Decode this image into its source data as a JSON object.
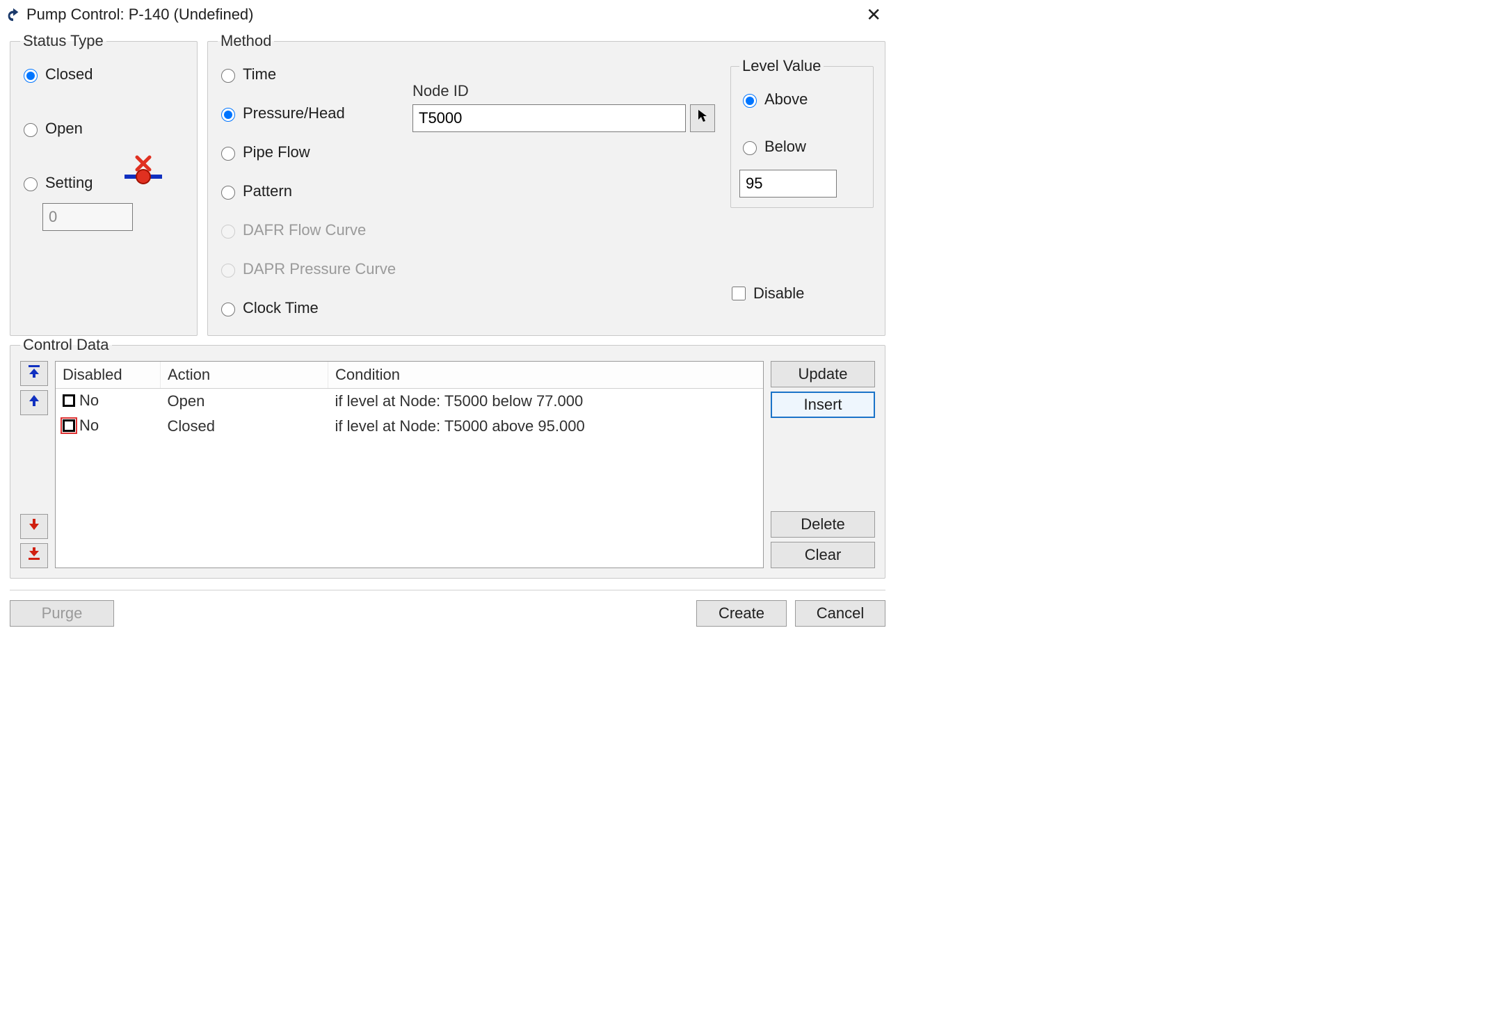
{
  "title": "Pump Control: P-140 (Undefined)",
  "status": {
    "legend": "Status Type",
    "options": {
      "closed": "Closed",
      "open": "Open",
      "setting": "Setting"
    },
    "selected": "closed",
    "setting_value": "0"
  },
  "method": {
    "legend": "Method",
    "options": {
      "time": "Time",
      "pressure": "Pressure/Head",
      "pipeflow": "Pipe Flow",
      "pattern": "Pattern",
      "dafr": "DAFR Flow Curve",
      "dapr": "DAPR Pressure Curve",
      "clock": "Clock Time"
    },
    "selected": "pressure",
    "node_label": "Node ID",
    "node_value": "T5000"
  },
  "level": {
    "legend": "Level Value",
    "options": {
      "above": "Above",
      "below": "Below"
    },
    "selected": "above",
    "value": "95",
    "disable_label": "Disable",
    "disable_checked": false
  },
  "control": {
    "legend": "Control Data",
    "columns": {
      "disabled": "Disabled",
      "action": "Action",
      "condition": "Condition"
    },
    "rows": [
      {
        "disabled": "No",
        "action": "Open",
        "condition": "if level at Node: T5000 below 77.000",
        "selected": false
      },
      {
        "disabled": "No",
        "action": "Closed",
        "condition": "if level at Node: T5000 above 95.000",
        "selected": true
      }
    ],
    "buttons": {
      "update": "Update",
      "insert": "Insert",
      "delete": "Delete",
      "clear": "Clear"
    }
  },
  "footer": {
    "purge": "Purge",
    "create": "Create",
    "cancel": "Cancel"
  }
}
